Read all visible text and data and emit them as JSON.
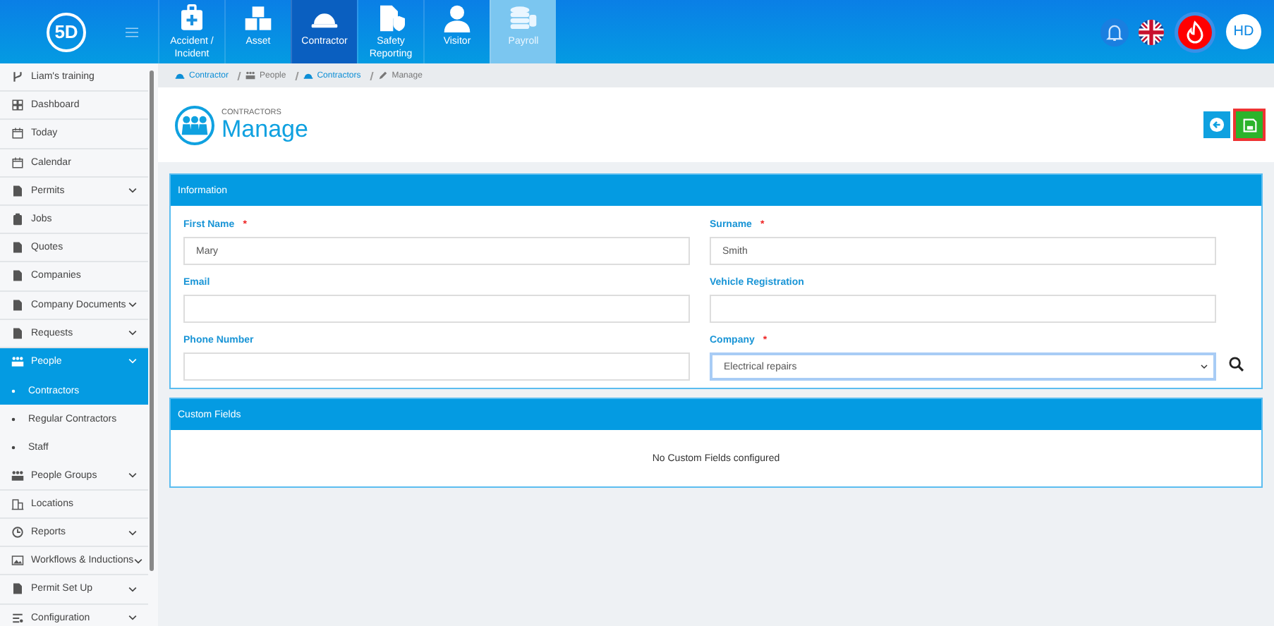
{
  "topbar": {
    "logo": "5D",
    "modules": [
      {
        "label": "Accident / Incident",
        "selected": false,
        "disabled": false
      },
      {
        "label": "Asset",
        "selected": false,
        "disabled": false
      },
      {
        "label": "Contractor",
        "selected": true,
        "disabled": false
      },
      {
        "label": "Safety Reporting",
        "selected": false,
        "disabled": false
      },
      {
        "label": "Visitor",
        "selected": false,
        "disabled": false
      },
      {
        "label": "Payroll",
        "selected": false,
        "disabled": true
      }
    ],
    "user_initials": "HD"
  },
  "sidebar": {
    "items": [
      {
        "label": "Liam's training",
        "expandable": false,
        "selected": false
      },
      {
        "label": "Dashboard",
        "expandable": false,
        "selected": false
      },
      {
        "label": "Today",
        "expandable": false,
        "selected": false
      },
      {
        "label": "Calendar",
        "expandable": false,
        "selected": false
      },
      {
        "label": "Permits",
        "expandable": true,
        "selected": false
      },
      {
        "label": "Jobs",
        "expandable": false,
        "selected": false
      },
      {
        "label": "Quotes",
        "expandable": false,
        "selected": false
      },
      {
        "label": "Companies",
        "expandable": false,
        "selected": false
      },
      {
        "label": "Company Documents",
        "expandable": true,
        "selected": false
      },
      {
        "label": "Requests",
        "expandable": true,
        "selected": false
      },
      {
        "label": "People",
        "expandable": true,
        "selected": true,
        "children": [
          {
            "label": "Contractors",
            "selected": true
          },
          {
            "label": "Regular Contractors",
            "selected": false
          },
          {
            "label": "Staff",
            "selected": false
          }
        ]
      },
      {
        "label": "People Groups",
        "expandable": true,
        "selected": false
      },
      {
        "label": "Locations",
        "expandable": false,
        "selected": false
      },
      {
        "label": "Reports",
        "expandable": true,
        "selected": false
      },
      {
        "label": "Workflows & Inductions",
        "expandable": true,
        "selected": false
      },
      {
        "label": "Permit Set Up",
        "expandable": true,
        "selected": false
      },
      {
        "label": "Configuration",
        "expandable": true,
        "selected": false
      }
    ]
  },
  "breadcrumb": [
    {
      "label": "Contractor",
      "link": true
    },
    {
      "label": "People",
      "link": false
    },
    {
      "label": "Contractors",
      "link": true
    },
    {
      "label": "Manage",
      "link": false
    }
  ],
  "header": {
    "overline": "CONTRACTORS",
    "title": "Manage"
  },
  "information": {
    "title": "Information",
    "fields": [
      {
        "label": "First Name",
        "required_mark": "*",
        "kind": "text",
        "value": "Mary",
        "focused": false
      },
      {
        "label": "Surname",
        "required_mark": "*",
        "kind": "text",
        "value": "Smith",
        "focused": false
      },
      {
        "label": "Email",
        "kind": "text",
        "focused": false
      },
      {
        "label": "Vehicle Registration",
        "kind": "text",
        "focused": false
      },
      {
        "label": "Phone Number",
        "kind": "text",
        "focused": false
      },
      {
        "label": "Company",
        "required_mark": "*",
        "kind": "select",
        "value": "Electrical repairs",
        "focused": true
      }
    ]
  },
  "custom_fields": {
    "title": "Custom Fields",
    "message": "No Custom Fields configured"
  }
}
